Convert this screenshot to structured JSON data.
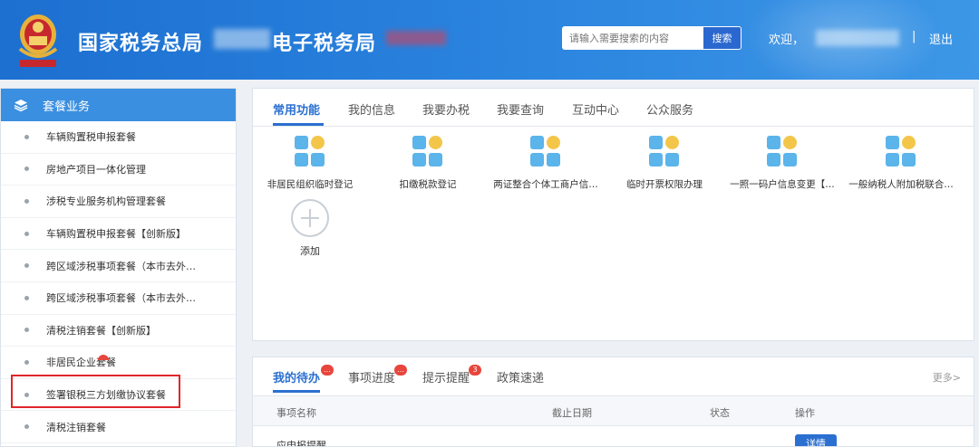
{
  "header": {
    "title": "国家税务总局",
    "title_suffix": "电子税务局",
    "search_placeholder": "请输入需要搜索的内容",
    "search_button": "搜索",
    "welcome": "欢迎，",
    "separator": "|",
    "logout": "退出"
  },
  "sidebar": {
    "title": "套餐业务",
    "items": [
      {
        "label": "车辆购置税申报套餐"
      },
      {
        "label": "房地产项目一体化管理"
      },
      {
        "label": "涉税专业服务机构管理套餐"
      },
      {
        "label": "车辆购置税申报套餐【创新版】"
      },
      {
        "label": "跨区域涉税事项套餐（本市去外…"
      },
      {
        "label": "跨区域涉税事项套餐（本市去外…"
      },
      {
        "label": "清税注销套餐【创新版】"
      },
      {
        "label": "非居民企业套餐"
      },
      {
        "label": "签署银税三方划缴协议套餐"
      },
      {
        "label": "清税注销套餐"
      }
    ]
  },
  "main": {
    "tabs": [
      {
        "label": "常用功能"
      },
      {
        "label": "我的信息"
      },
      {
        "label": "我要办税"
      },
      {
        "label": "我要查询"
      },
      {
        "label": "互动中心"
      },
      {
        "label": "公众服务"
      }
    ],
    "functions": [
      {
        "label": "非居民组织临时登记"
      },
      {
        "label": "扣缴税款登记"
      },
      {
        "label": "两证整合个体工商户信…"
      },
      {
        "label": "临时开票权限办理"
      },
      {
        "label": "一照一码户信息变更【…"
      },
      {
        "label": "一般纳税人附加税联合…"
      }
    ],
    "add_label": "添加"
  },
  "todo": {
    "tabs": [
      {
        "label": "我的待办",
        "badge": "…"
      },
      {
        "label": "事项进度",
        "badge": "…"
      },
      {
        "label": "提示提醒",
        "badge": "3"
      },
      {
        "label": "政策速递"
      }
    ],
    "more": "更多>",
    "columns": [
      "事项名称",
      "截止日期",
      "状态",
      "操作"
    ],
    "row_name": "应申报提醒",
    "detail_button": "详情"
  },
  "colors": {
    "header_blue": "#2a83de",
    "accent": "#2b6fd1",
    "highlight_red": "#e0262b"
  }
}
